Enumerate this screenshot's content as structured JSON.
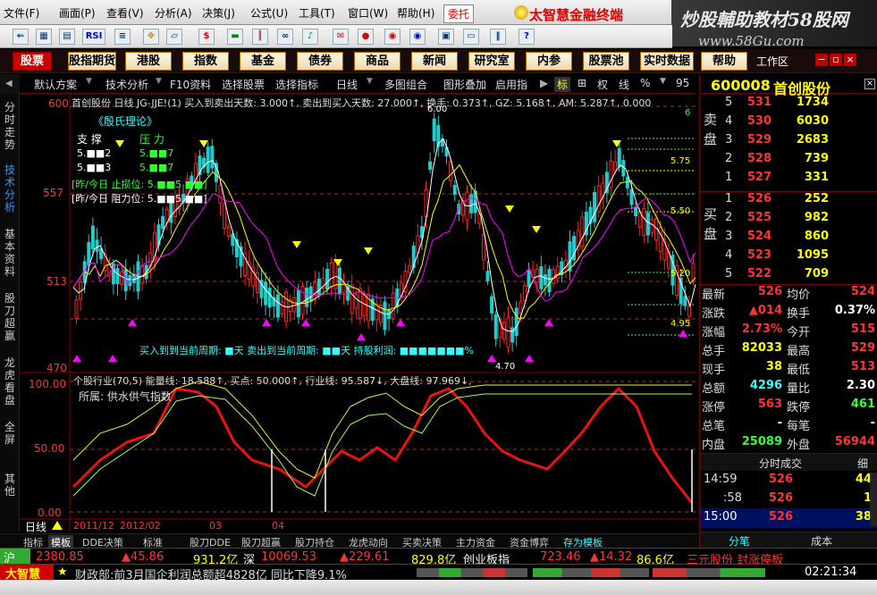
{
  "menu": [
    "文件(F)",
    "画面(P)",
    "查看(V)",
    "分析(A)",
    "决策(J)",
    "公式(U)",
    "工具(T)",
    "窗口(W)",
    "帮助(H)"
  ],
  "weituo_label": "委托",
  "brand_title": "太智慧金融终端",
  "top_ad": {
    "line1": "炒股輔助教材58股网",
    "line2": "www.58Gu.com"
  },
  "toolbar_icons": [
    "back-icon",
    "grid-icon",
    "chart-icon",
    "rsi-icon",
    "settings-icon",
    "move-icon",
    "ruler-icon",
    "dollar-icon",
    "flag-icon",
    "bars-icon",
    "binocular-icon",
    "bell-icon",
    "mail-icon",
    "pill-icon",
    "pill-blue-icon",
    "disk-icon",
    "screen-icon",
    "pause-icon",
    "help-icon"
  ],
  "toolbar": {
    "rsi": "RSI",
    "dollar": "$",
    "help": "?"
  },
  "navbar": {
    "items": [
      "股票",
      "股指期货",
      "港股",
      "指数",
      "基金",
      "债券",
      "商品",
      "新闻",
      "研究室",
      "内参",
      "股票池",
      "实时数据",
      "帮助"
    ],
    "selected": "股票",
    "workarea": "工作区"
  },
  "window_buttons": {
    "minimize": "−",
    "restore": "▫",
    "close": "×"
  },
  "subtabs": [
    "默认方案",
    "技术分析",
    "F10资料",
    "选择股票",
    "选择指标",
    "日线",
    "多图组合",
    "图形叠加",
    "启用指",
    "标",
    "权",
    "线",
    "%",
    "95"
  ],
  "subtab_symbols": {
    "left_arrow": "◀",
    "right_arrow": "▶",
    "grid": "⊞",
    "caret": "▼"
  },
  "left_side": [
    "分时走势",
    "技术分析",
    "基本资料",
    "股刀超赢",
    "龙虎看盘",
    "全屏",
    "其他"
  ],
  "chart_header": "首创股份 日线 JG-JJE!(1) 买入到卖出天数: 3.000↑, 卖出到买入天数: 27.000↑, 换手: 0.373↑, GZ: 5.168↑, AM: 5.287↑, 0.000",
  "chart_overlay": {
    "theory": "《殷氏理论》",
    "support": "支 撑",
    "pressure": "压 力",
    "s1": "5.■■2",
    "p1": "5.■■7",
    "s2": "5.■■3",
    "p2": "5.■■7",
    "zhisun": "[昨/今日 止损位: 5.■■5 ■■]",
    "zuli": "[昨/今日 阻力位: 5.■■5 ■■]",
    "bottom_note": "买入到到当前周期: ■天  卖出到当前周期: ■■天  持股利润: ■■■■■■■%"
  },
  "chart_data": {
    "type": "candlestick",
    "price_axis_labels": [
      "600",
      "557",
      "513",
      "470"
    ],
    "right_levels": [
      "6",
      "5.75",
      "5.50",
      "5.20",
      "4.95"
    ],
    "high_label": "6.00",
    "low_label": "4.70",
    "x_labels": [
      "2011/12",
      "2012/02",
      "03",
      "04"
    ],
    "indicator_header": "个股行业(70,5)  能量线: 18.588↑, 买点: 50.000↑, 行业线: 95.587↓, 大盘线: 97.969↓,",
    "indicator_sub": "所属: 供水供气指数",
    "indicator_axis_labels": [
      "100.00",
      "50.00",
      "0.00"
    ],
    "indicator_side_labels": [
      "日线"
    ]
  },
  "bottom_tabs": [
    "指标",
    "模板",
    "DDE决策",
    "标准",
    "股刀DDE",
    "股刀超赢",
    "股刀持仓",
    "龙虎动向",
    "买卖决策",
    "主力资金",
    "资金博弈",
    "存为模板"
  ],
  "right_panel": {
    "code": "600008",
    "name": "首创股份",
    "sell_label": "卖盘",
    "buy_label": "买盘",
    "sell": [
      {
        "lv": "5",
        "price": "531",
        "vol": "1734"
      },
      {
        "lv": "4",
        "price": "530",
        "vol": "6030"
      },
      {
        "lv": "3",
        "price": "529",
        "vol": "2683"
      },
      {
        "lv": "2",
        "price": "528",
        "vol": "739"
      },
      {
        "lv": "1",
        "price": "527",
        "vol": "331"
      }
    ],
    "buy": [
      {
        "lv": "1",
        "price": "526",
        "vol": "252"
      },
      {
        "lv": "2",
        "price": "525",
        "vol": "982"
      },
      {
        "lv": "3",
        "price": "524",
        "vol": "860"
      },
      {
        "lv": "4",
        "price": "523",
        "vol": "1095"
      },
      {
        "lv": "5",
        "price": "522",
        "vol": "709"
      }
    ],
    "quotes": [
      {
        "k": "最新",
        "v": "526",
        "k2": "均价",
        "v2": "524",
        "c1": "red",
        "c2": "red"
      },
      {
        "k": "涨跌",
        "v": "▲014",
        "k2": "换手",
        "v2": "0.37%",
        "c1": "red",
        "c2": "wht"
      },
      {
        "k": "涨幅",
        "v": "2.73%",
        "k2": "今开",
        "v2": "515",
        "c1": "red",
        "c2": "red"
      },
      {
        "k": "总手",
        "v": "82033",
        "k2": "最高",
        "v2": "529",
        "c1": "yel",
        "c2": "red"
      },
      {
        "k": "现手",
        "v": "38",
        "k2": "最低",
        "v2": "513",
        "c1": "yel",
        "c2": "red"
      },
      {
        "k": "总额",
        "v": "4296",
        "k2": "量比",
        "v2": "2.30",
        "c1": "cyn",
        "c2": "wht"
      },
      {
        "k": "涨停",
        "v": "563",
        "k2": "跌停",
        "v2": "461",
        "c1": "red",
        "c2": "grn"
      },
      {
        "k": "总笔",
        "v": "-",
        "k2": "每笔",
        "v2": "-",
        "c1": "wht",
        "c2": "wht"
      },
      {
        "k": "内盘",
        "v": "25089",
        "k2": "外盘",
        "v2": "56944",
        "c1": "grn",
        "c2": "red"
      }
    ],
    "trade_title": "分时成交",
    "trade_detail": "细",
    "trades": [
      {
        "t": "14:59",
        "p": "526",
        "v": "44"
      },
      {
        "t": ":58",
        "p": "526",
        "v": "1"
      },
      {
        "t": "15:00",
        "p": "526",
        "v": "38"
      }
    ],
    "bottom_tabs": [
      "分笔",
      "成本"
    ]
  },
  "ticker": {
    "sh_label": "沪",
    "sh_index": "2380.85",
    "sh_change": "▲45.86",
    "sh_amount": "931.2亿",
    "sz_label": "深",
    "sz_index": "10069.53",
    "sz_change": "▲229.61",
    "sz_amount": "829.8亿",
    "board": "创业板指",
    "board_index": "723.46",
    "board_change": "▲14.32",
    "board_amount": "86.6亿",
    "alert": "三元股份 封涨停板"
  },
  "news": {
    "logo": "大智慧",
    "text": "财政部:前3月国企利润总额超4828亿 同比下降9.1%",
    "time": "02:21:34"
  }
}
